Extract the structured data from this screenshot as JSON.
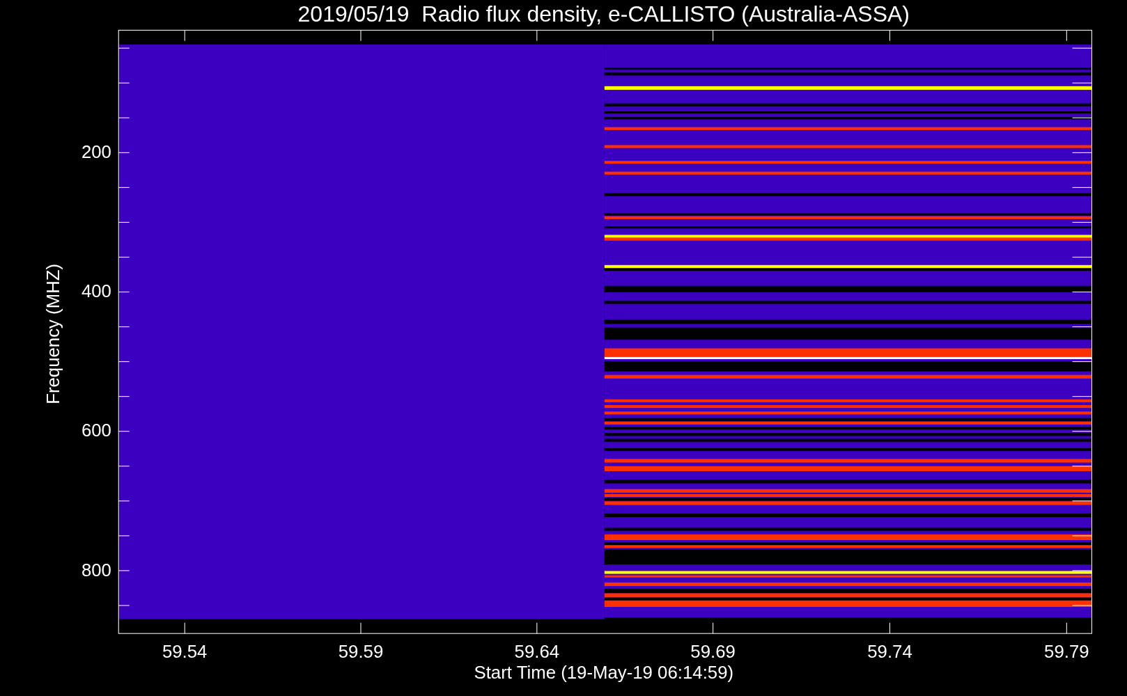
{
  "plot": {
    "title": "2019/05/19  Radio flux density, e-CALLISTO (Australia-ASSA)",
    "xlabel": "Start Time (19-May-19 06:14:59)",
    "ylabel": "Frequency (MHZ)",
    "xtick_labels": [
      "59.54",
      "59.59",
      "59.64",
      "59.69",
      "59.74",
      "59.79"
    ],
    "ytick_labels": [
      "200",
      "400",
      "600",
      "800"
    ]
  }
}
